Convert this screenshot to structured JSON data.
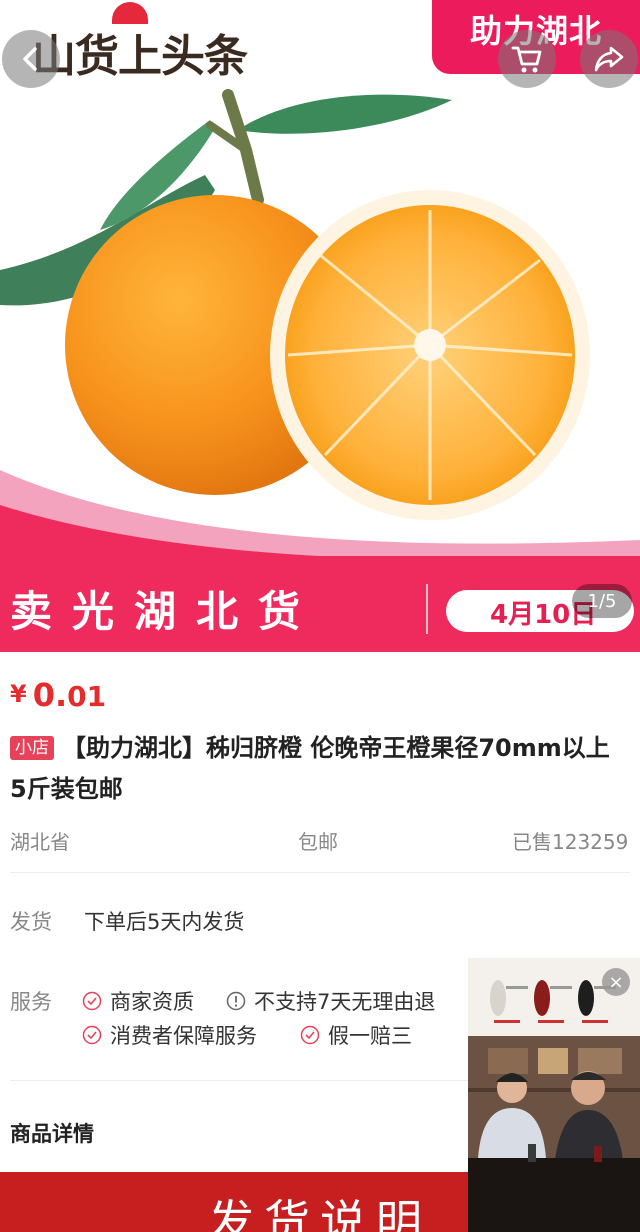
{
  "hero": {
    "logo_text": "山货上头条",
    "banner_text": "助力湖北",
    "slogan": "卖光湖北货",
    "date": "4月10日",
    "image_counter": "1/5",
    "icons": [
      "back-icon",
      "cart-icon",
      "share-icon"
    ]
  },
  "product": {
    "price_currency": "¥",
    "price_int": "0.",
    "price_dec": "01",
    "shop_tag": "小店",
    "title": "【助力湖北】秭归脐橙 伦晚帝王橙果径70mm以上 5斤装包邮",
    "origin": "湖北省",
    "shipping_fee": "包邮",
    "sold": "已售123259"
  },
  "shipping": {
    "label": "发货",
    "value": "下单后5天内发货"
  },
  "service": {
    "label": "服务",
    "items": [
      {
        "text": "商家资质",
        "icon": "check-circle-icon"
      },
      {
        "text": "不支持7天无理由退",
        "icon": "info-circle-icon"
      },
      {
        "text": "消费者保障服务",
        "icon": "check-circle-icon"
      },
      {
        "text": "假一赔三",
        "icon": "check-circle-icon"
      }
    ]
  },
  "details": {
    "title": "商品详情",
    "banner_text": "发货说明"
  },
  "video": {
    "close": "×"
  },
  "colors": {
    "accent": "#ee2b5c",
    "price": "#e52b2b",
    "detail_banner": "#c71f1f"
  }
}
